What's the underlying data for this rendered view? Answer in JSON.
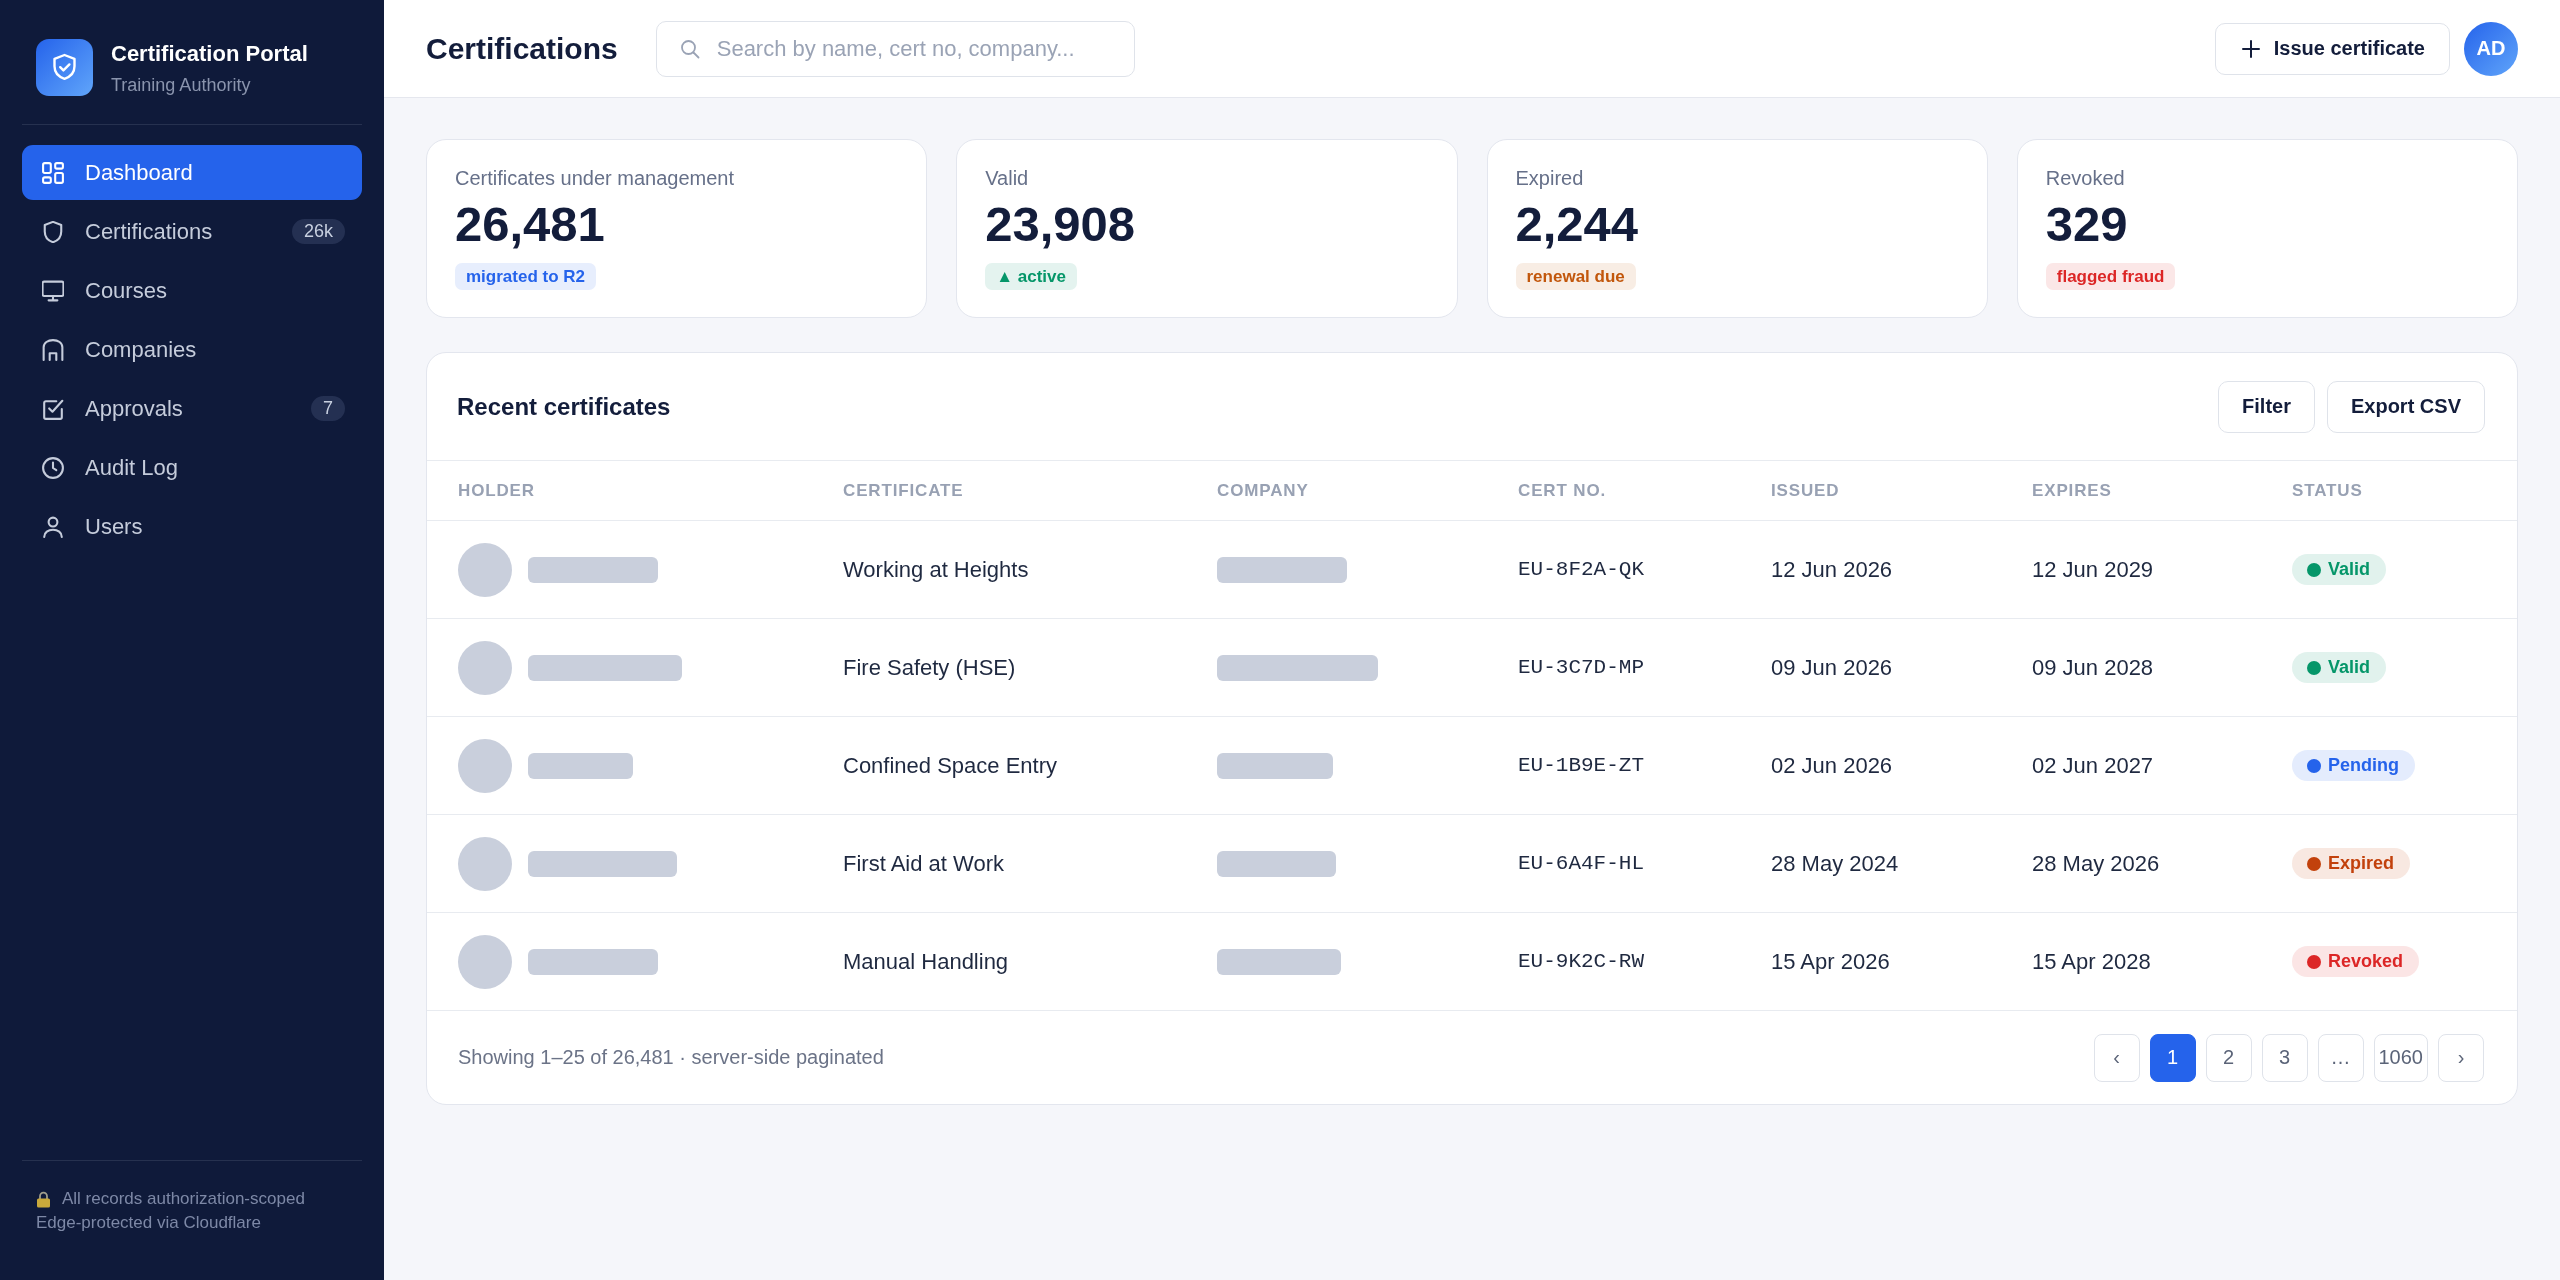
{
  "sidebar": {
    "brand": {
      "title": "Certification Portal",
      "subtitle": "Training Authority"
    },
    "items": [
      {
        "label": "Dashboard",
        "selected": true
      },
      {
        "label": "Certifications",
        "badge": "26k",
        "selected": false
      },
      {
        "label": "Courses",
        "selected": false
      },
      {
        "label": "Companies",
        "selected": false
      },
      {
        "label": "Approvals",
        "badge": "7",
        "selected": false
      },
      {
        "label": "Audit Log",
        "selected": false
      },
      {
        "label": "Users",
        "selected": false
      }
    ],
    "footer": [
      "All records authorization-scoped",
      "Edge-protected via Cloudflare"
    ]
  },
  "header": {
    "title": "Certifications",
    "search": {
      "placeholder": "Search by name, cert no, company..."
    },
    "primary_button": "Issue certificate",
    "avatar": "AD"
  },
  "stats": [
    {
      "label": "Certificates under management",
      "value": "26,481",
      "badge": {
        "text": "migrated to R2",
        "color": "#2563eb"
      }
    },
    {
      "label": "Valid",
      "value": "23,908",
      "badge": {
        "text": "▲ active",
        "color": "#059669"
      }
    },
    {
      "label": "Expired",
      "value": "2,244",
      "badge": {
        "text": "renewal due",
        "color": "#c2570c"
      }
    },
    {
      "label": "Revoked",
      "value": "329",
      "badge": {
        "text": "flagged fraud",
        "color": "#dc2626"
      }
    }
  ],
  "table": {
    "title": "Recent certificates",
    "actions": [
      "Filter",
      "Export CSV"
    ],
    "columns": [
      "HOLDER",
      "CERTIFICATE",
      "COMPANY",
      "CERT NO.",
      "ISSUED",
      "EXPIRES",
      "STATUS"
    ],
    "rows": [
      {
        "certificate": "Working at Heights",
        "cert_no": "EU-8F2A-QK",
        "issued": "12 Jun 2026",
        "expires": "12 Jun 2029",
        "status": {
          "label": "Valid",
          "color": "#059669"
        }
      },
      {
        "certificate": "Fire Safety (HSE)",
        "cert_no": "EU-3C7D-MP",
        "issued": "09 Jun 2026",
        "expires": "09 Jun 2028",
        "status": {
          "label": "Valid",
          "color": "#059669"
        }
      },
      {
        "certificate": "Confined Space Entry",
        "cert_no": "EU-1B9E-ZT",
        "issued": "02 Jun 2026",
        "expires": "02 Jun 2027",
        "status": {
          "label": "Pending",
          "color": "#2563eb"
        }
      },
      {
        "certificate": "First Aid at Work",
        "cert_no": "EU-6A4F-HL",
        "issued": "28 May 2024",
        "expires": "28 May 2026",
        "status": {
          "label": "Expired",
          "color": "#c2410c"
        }
      },
      {
        "certificate": "Manual Handling",
        "cert_no": "EU-9K2C-RW",
        "issued": "15 Apr 2026",
        "expires": "15 Apr 2028",
        "status": {
          "label": "Revoked",
          "color": "#dc2626"
        }
      }
    ],
    "footer": "Showing 1–25 of 26,481 · server-side paginated",
    "pagination": [
      {
        "label": "‹",
        "selected": false
      },
      {
        "label": "1",
        "selected": true
      },
      {
        "label": "2",
        "selected": false
      },
      {
        "label": "3",
        "selected": false
      },
      {
        "label": "…",
        "selected": false
      },
      {
        "label": "1060",
        "selected": false
      },
      {
        "label": "›",
        "selected": false
      }
    ]
  }
}
